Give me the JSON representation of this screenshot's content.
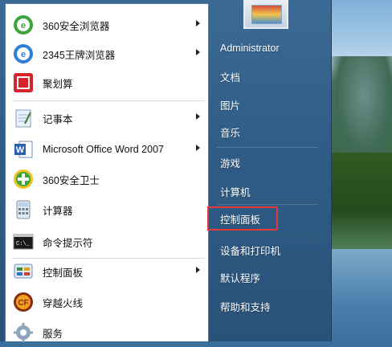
{
  "left_menu": {
    "items": [
      {
        "label": "360安全浏览器",
        "icon": "360-browser-icon",
        "has_submenu": true
      },
      {
        "label": "2345王牌浏览器",
        "icon": "2345-browser-icon",
        "has_submenu": true
      },
      {
        "label": "聚划算",
        "icon": "juhuasuan-icon",
        "has_submenu": false
      },
      {
        "label": "记事本",
        "icon": "notepad-icon",
        "has_submenu": true
      },
      {
        "label": "Microsoft Office Word 2007",
        "icon": "word-icon",
        "has_submenu": true
      },
      {
        "label": "360安全卫士",
        "icon": "360-safe-guard-icon",
        "has_submenu": false
      },
      {
        "label": "计算器",
        "icon": "calculator-icon",
        "has_submenu": false
      },
      {
        "label": "命令提示符",
        "icon": "command-prompt-icon",
        "has_submenu": false
      },
      {
        "label": "控制面板",
        "icon": "control-panel-icon",
        "has_submenu": true
      },
      {
        "label": "穿越火线",
        "icon": "crossfire-game-icon",
        "has_submenu": false
      },
      {
        "label": "服务",
        "icon": "services-gear-icon",
        "has_submenu": false
      }
    ]
  },
  "right_menu": {
    "items": [
      {
        "label": "Administrator"
      },
      {
        "label": "文档"
      },
      {
        "label": "图片"
      },
      {
        "label": "音乐"
      },
      {
        "label": "游戏"
      },
      {
        "label": "计算机"
      },
      {
        "label": "控制面板"
      },
      {
        "label": "设备和打印机"
      },
      {
        "label": "默认程序"
      },
      {
        "label": "帮助和支持"
      }
    ],
    "highlighted_item": "控制面板",
    "highlight_color": "#e6373a"
  },
  "colors": {
    "menu_right_pane": "#2f5c86",
    "left_pane_bg": "#ffffff"
  }
}
